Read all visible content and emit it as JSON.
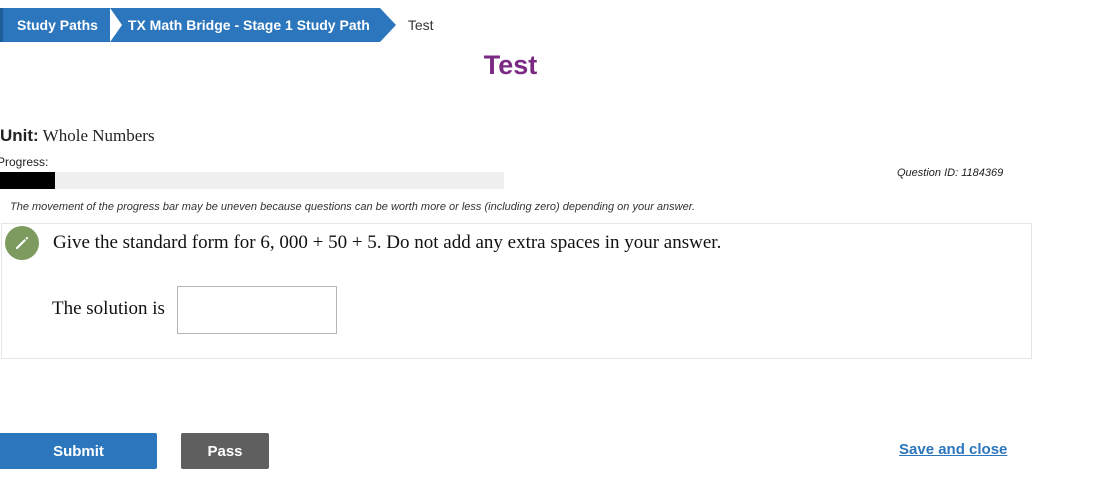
{
  "breadcrumb": {
    "items": [
      "Study Paths",
      "TX Math Bridge - Stage 1 Study Path"
    ],
    "current": "Test"
  },
  "page": {
    "title": "Test"
  },
  "unit": {
    "label": "Unit:",
    "name": "Whole Numbers"
  },
  "progress": {
    "label": "Progress:",
    "fraction": 0.11,
    "note": "The movement of the progress bar may be uneven because questions can be worth more or less (including zero) depending on your answer."
  },
  "question": {
    "id_text": "Question ID: 1184369",
    "prompt": "Give the standard form for 6, 000 + 50 + 5. Do not add any extra spaces in your answer.",
    "solution_label": "The solution is",
    "answer_value": "",
    "icon": "pencil-icon",
    "icon_color": "#7e9b5f"
  },
  "actions": {
    "submit_label": "Submit",
    "pass_label": "Pass",
    "save_close_label": "Save and close"
  },
  "colors": {
    "primary": "#2c76bd",
    "title": "#7b2a84",
    "pass_button": "#5f5f5f"
  }
}
